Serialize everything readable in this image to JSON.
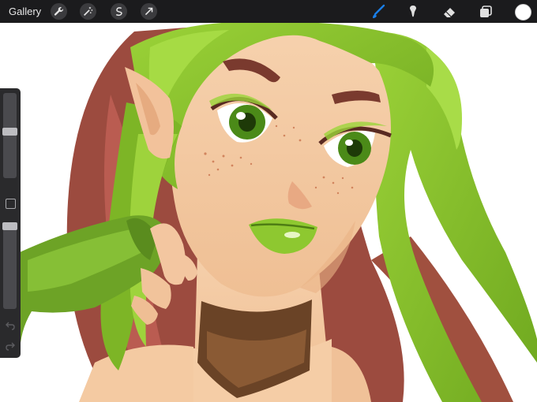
{
  "toolbar": {
    "gallery_label": "Gallery",
    "left_tools": [
      {
        "name": "wrench-icon"
      },
      {
        "name": "magic-wand-icon"
      },
      {
        "name": "selection-icon"
      },
      {
        "name": "transform-arrow-icon"
      }
    ],
    "right_tools": [
      {
        "name": "brush-icon",
        "active": true
      },
      {
        "name": "smudge-icon"
      },
      {
        "name": "eraser-icon"
      },
      {
        "name": "layers-icon"
      }
    ],
    "current_color": "#ffffff"
  },
  "sidebar": {
    "brush_size_level": 0.55,
    "opacity_level": 0.1
  },
  "colors": {
    "accent": "#1a7fe8",
    "hair_green": "#84bd2a",
    "hair_red": "#9a4a3e",
    "skin": "#f4c9a0",
    "lips": "#8ec830"
  }
}
